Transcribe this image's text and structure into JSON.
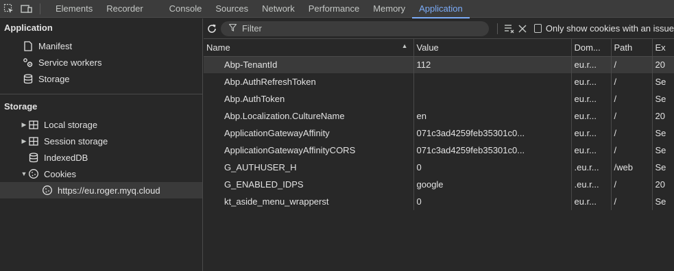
{
  "tabs": [
    {
      "label": "Elements"
    },
    {
      "label": "Recorder"
    },
    {
      "label": "Console"
    },
    {
      "label": "Sources"
    },
    {
      "label": "Network"
    },
    {
      "label": "Performance"
    },
    {
      "label": "Memory"
    },
    {
      "label": "Application"
    }
  ],
  "sidebar": {
    "application_header": "Application",
    "app_items": [
      {
        "label": "Manifest",
        "icon": "file-icon"
      },
      {
        "label": "Service workers",
        "icon": "gears-icon"
      },
      {
        "label": "Storage",
        "icon": "database-icon"
      }
    ],
    "storage_header": "Storage",
    "storage_items": [
      {
        "label": "Local storage",
        "icon": "table-icon"
      },
      {
        "label": "Session storage",
        "icon": "table-icon"
      },
      {
        "label": "IndexedDB",
        "icon": "database-icon"
      },
      {
        "label": "Cookies",
        "icon": "cookie-icon"
      },
      {
        "label": "https://eu.roger.myq.cloud",
        "icon": "cookie-icon"
      }
    ]
  },
  "toolbar": {
    "filter_placeholder": "Filter",
    "only_show_label": "Only show cookies with an issue"
  },
  "table": {
    "headers": [
      "Name",
      "Value",
      "Dom...",
      "Path",
      "Ex"
    ],
    "rows": [
      {
        "name": "Abp-TenantId",
        "value": "112",
        "domain": "eu.r...",
        "path": "/",
        "expires": "20"
      },
      {
        "name": "Abp.AuthRefreshToken",
        "value": "",
        "domain": "eu.r...",
        "path": "/",
        "expires": "Se"
      },
      {
        "name": "Abp.AuthToken",
        "value": "",
        "domain": "eu.r...",
        "path": "/",
        "expires": "Se"
      },
      {
        "name": "Abp.Localization.CultureName",
        "value": "en",
        "domain": "eu.r...",
        "path": "/",
        "expires": "20"
      },
      {
        "name": "ApplicationGatewayAffinity",
        "value": "071c3ad4259feb35301c0...",
        "domain": "eu.r...",
        "path": "/",
        "expires": "Se"
      },
      {
        "name": "ApplicationGatewayAffinityCORS",
        "value": "071c3ad4259feb35301c0...",
        "domain": "eu.r...",
        "path": "/",
        "expires": "Se"
      },
      {
        "name": "G_AUTHUSER_H",
        "value": "0",
        "domain": ".eu.r...",
        "path": "/web",
        "expires": "Se"
      },
      {
        "name": "G_ENABLED_IDPS",
        "value": "google",
        "domain": ".eu.r...",
        "path": "/",
        "expires": "20"
      },
      {
        "name": "kt_aside_menu_wrapperst",
        "value": "0",
        "domain": "eu.r...",
        "path": "/",
        "expires": "Se"
      }
    ]
  },
  "colors": {
    "accent": "#7cacf8",
    "background": "#282828",
    "tabbar": "#3c3c3c",
    "selected_row": "#3a3a3a"
  }
}
